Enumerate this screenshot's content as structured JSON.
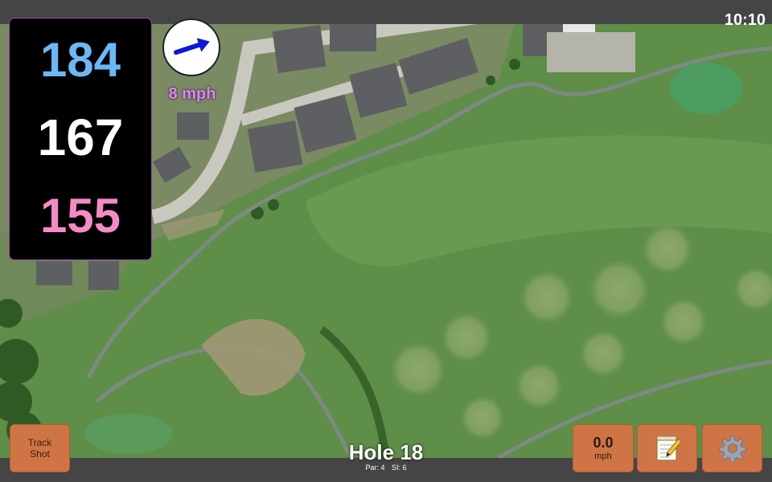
{
  "status": {
    "time": "10:10"
  },
  "distances": {
    "back": {
      "value": "184",
      "color": "#6cb8f5"
    },
    "middle": {
      "value": "167",
      "color": "#ffffff"
    },
    "front": {
      "value": "155",
      "color": "#f58bc6"
    }
  },
  "wind": {
    "speed": "8 mph",
    "direction_icon": "arrow-right-icon",
    "arrow_color": "#0b18d8"
  },
  "buttons": {
    "track_shot_line1": "Track",
    "track_shot_line2": "Shot",
    "speed_value": "0.0",
    "speed_unit": "mph",
    "notes_icon": "notepad-icon",
    "settings_icon": "gear-icon"
  },
  "hole": {
    "title": "Hole 18",
    "par": "Par: 4",
    "stroke_index": "SI: 6"
  },
  "colors": {
    "button_bg": "#cf7545",
    "panel_border": "#9b4bb5",
    "bar_bg": "#454545"
  }
}
